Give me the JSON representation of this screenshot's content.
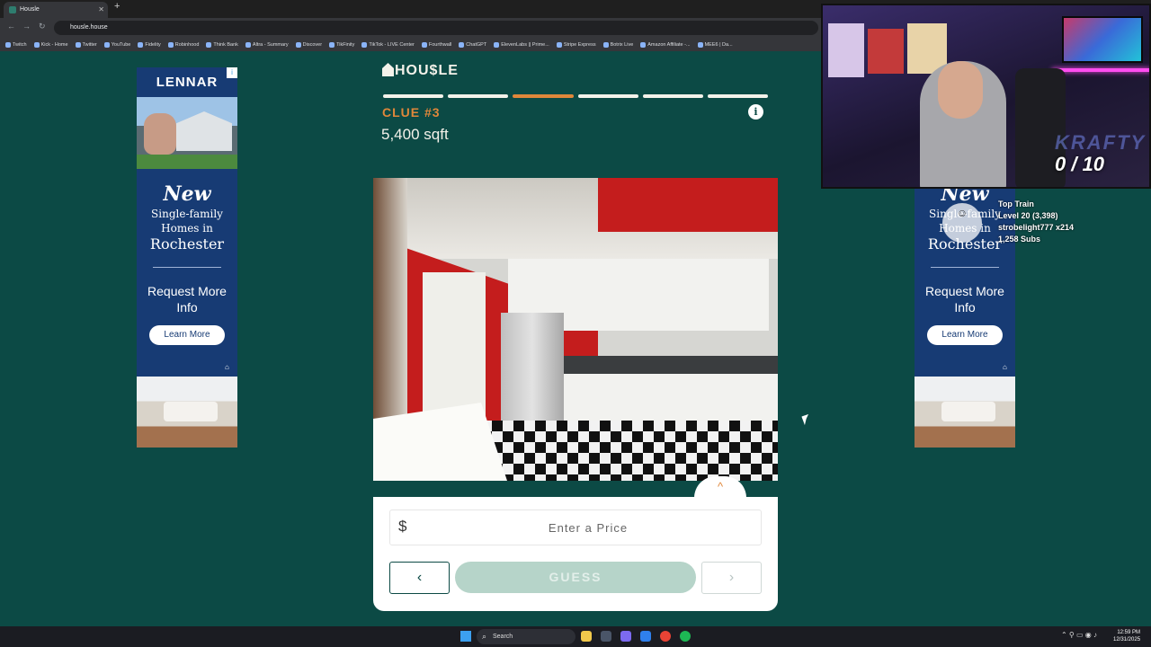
{
  "browser": {
    "tab_title": "Housle",
    "url": "housle.house",
    "bookmarks": [
      "Twitch",
      "Kick - Home",
      "Twitter",
      "YouTube",
      "Fidelity",
      "Robinhood",
      "Think Bank",
      "Altra - Summary",
      "Discover",
      "TikFinity",
      "TikTok - LIVE Center",
      "Fourthwall",
      "ChatGPT",
      "ElevenLabs || Prime...",
      "Stripe Express",
      "Botrix Live",
      "Amazon Affiliate -...",
      "MEE6 | Da..."
    ]
  },
  "ads": {
    "brand": "LENNAR",
    "new": "New",
    "sub": "Single-family Homes in",
    "city": "Rochester",
    "request": "Request More Info",
    "cta": "Learn More"
  },
  "game": {
    "logo": "HOU$LE",
    "progress": {
      "total": 6,
      "current": 3
    },
    "clue_label": "CLUE #3",
    "clue_value": "5,400 sqft",
    "price_symbol": "$",
    "price_placeholder": "Enter a Price",
    "guess_label": "GUESS",
    "back_glyph": "‹",
    "next_glyph": "›",
    "expand_glyph": "^"
  },
  "stream": {
    "score": "0 / 10",
    "overlay": {
      "title": "Top Train",
      "level": "Level 20 (3,398)",
      "user": "strobelight777 x214",
      "subs": "1,258 Subs"
    }
  },
  "taskbar": {
    "search": "Search",
    "time": "12:59 PM",
    "date": "12/31/2025"
  }
}
